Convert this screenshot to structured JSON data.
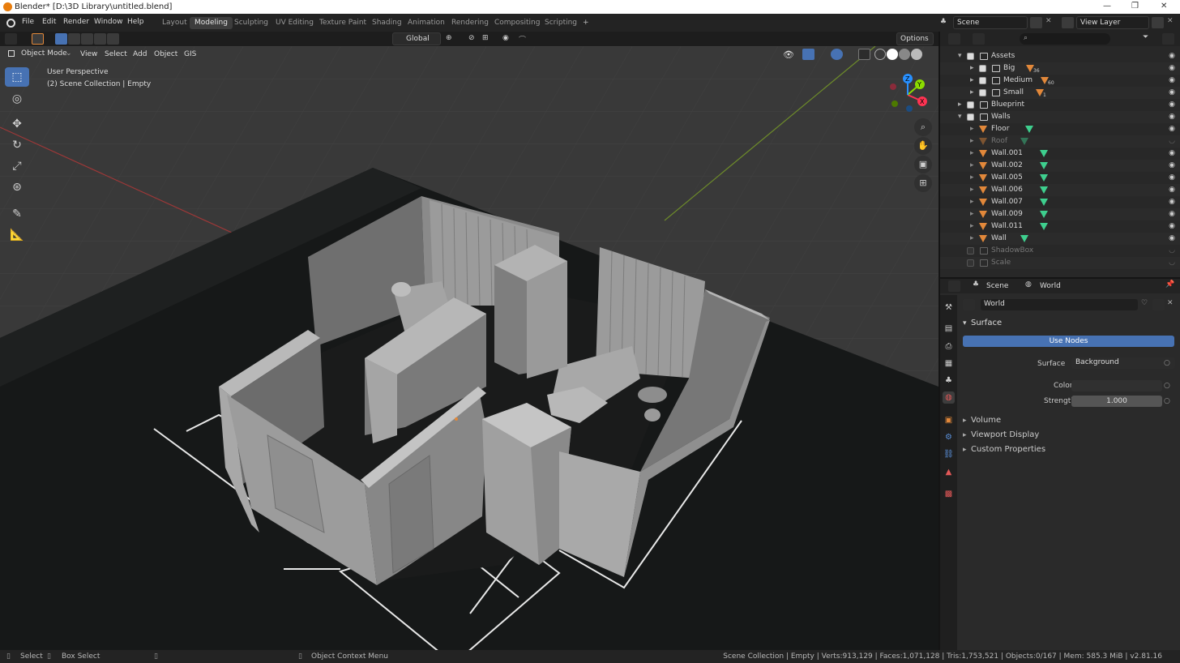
{
  "window": {
    "title": "Blender* [D:\\3D Library\\untitled.blend]",
    "minimize": "—",
    "maximize": "❐",
    "close": "✕"
  },
  "menu": [
    "File",
    "Edit",
    "Render",
    "Window",
    "Help"
  ],
  "workspaces": [
    "Layout",
    "Modeling",
    "Sculpting",
    "UV Editing",
    "Texture Paint",
    "Shading",
    "Animation",
    "Rendering",
    "Compositing",
    "Scripting"
  ],
  "active_workspace": "Modeling",
  "add_workspace": "+",
  "scene_selector": "Scene",
  "view_layer_selector": "View Layer",
  "viewport_header": {
    "transform_orientation": "Global",
    "options": "Options",
    "mode": "Object Mode",
    "menus": [
      "View",
      "Select",
      "Add",
      "Object",
      "GIS"
    ]
  },
  "viewport_overlay": {
    "line1": "User Perspective",
    "line2": "(2) Scene Collection | Empty"
  },
  "gizmo": {
    "x": "X",
    "y": "Y",
    "z": "Z"
  },
  "colors": {
    "accent": "#4772b3",
    "object_orange": "#e2883a",
    "mesh_green": "#3ecf8e",
    "axis_red": "#ff3352",
    "axis_green": "#8bdc00",
    "axis_blue": "#2890ff"
  },
  "outliner": {
    "rows": [
      {
        "label": "Assets",
        "type": "collection",
        "depth": 1,
        "expanded": true,
        "checked": true,
        "visible": true
      },
      {
        "label": "Big",
        "type": "collection",
        "depth": 2,
        "expanded": false,
        "checked": true,
        "visible": true,
        "badge": "36"
      },
      {
        "label": "Medium",
        "type": "collection",
        "depth": 2,
        "expanded": false,
        "checked": true,
        "visible": true,
        "badge": "60"
      },
      {
        "label": "Small",
        "type": "collection",
        "depth": 2,
        "expanded": false,
        "checked": true,
        "visible": true,
        "badge": "1"
      },
      {
        "label": "Blueprint",
        "type": "collection",
        "depth": 1,
        "expanded": false,
        "checked": true,
        "visible": true
      },
      {
        "label": "Walls",
        "type": "collection",
        "depth": 1,
        "expanded": true,
        "checked": true,
        "visible": true
      },
      {
        "label": "Floor",
        "type": "mesh",
        "depth": 2,
        "visible": true
      },
      {
        "label": "Roof",
        "type": "mesh",
        "depth": 2,
        "visible": false
      },
      {
        "label": "Wall.001",
        "type": "mesh",
        "depth": 2,
        "visible": true
      },
      {
        "label": "Wall.002",
        "type": "mesh",
        "depth": 2,
        "visible": true
      },
      {
        "label": "Wall.005",
        "type": "mesh",
        "depth": 2,
        "visible": true
      },
      {
        "label": "Wall.006",
        "type": "mesh",
        "depth": 2,
        "visible": true
      },
      {
        "label": "Wall.007",
        "type": "mesh",
        "depth": 2,
        "visible": true
      },
      {
        "label": "Wall.009",
        "type": "mesh",
        "depth": 2,
        "visible": true
      },
      {
        "label": "Wall.011",
        "type": "mesh",
        "depth": 2,
        "visible": true
      },
      {
        "label": "Wall",
        "type": "mesh",
        "depth": 2,
        "visible": true
      },
      {
        "label": "ShadowBox",
        "type": "collection",
        "depth": 1,
        "checked": false,
        "visible": false
      },
      {
        "label": "Scale",
        "type": "collection",
        "depth": 1,
        "checked": false,
        "visible": false
      }
    ]
  },
  "properties": {
    "breadcrumb_scene": "Scene",
    "breadcrumb_world": "World",
    "world_name": "World",
    "surface_section": "Surface",
    "use_nodes": "Use Nodes",
    "surface_label": "Surface",
    "surface_value": "Background",
    "color_label": "Color",
    "strength_label": "Strength",
    "strength_value": "1.000",
    "sections": [
      "Volume",
      "Viewport Display",
      "Custom Properties"
    ]
  },
  "statusbar": {
    "select": "Select",
    "box_select": "Box Select",
    "context_menu": "Object Context Menu",
    "stats": "Scene Collection | Empty | Verts:913,129 | Faces:1,071,128 | Tris:1,753,521 | Objects:0/167 | Mem: 585.3 MiB | v2.81.16"
  }
}
